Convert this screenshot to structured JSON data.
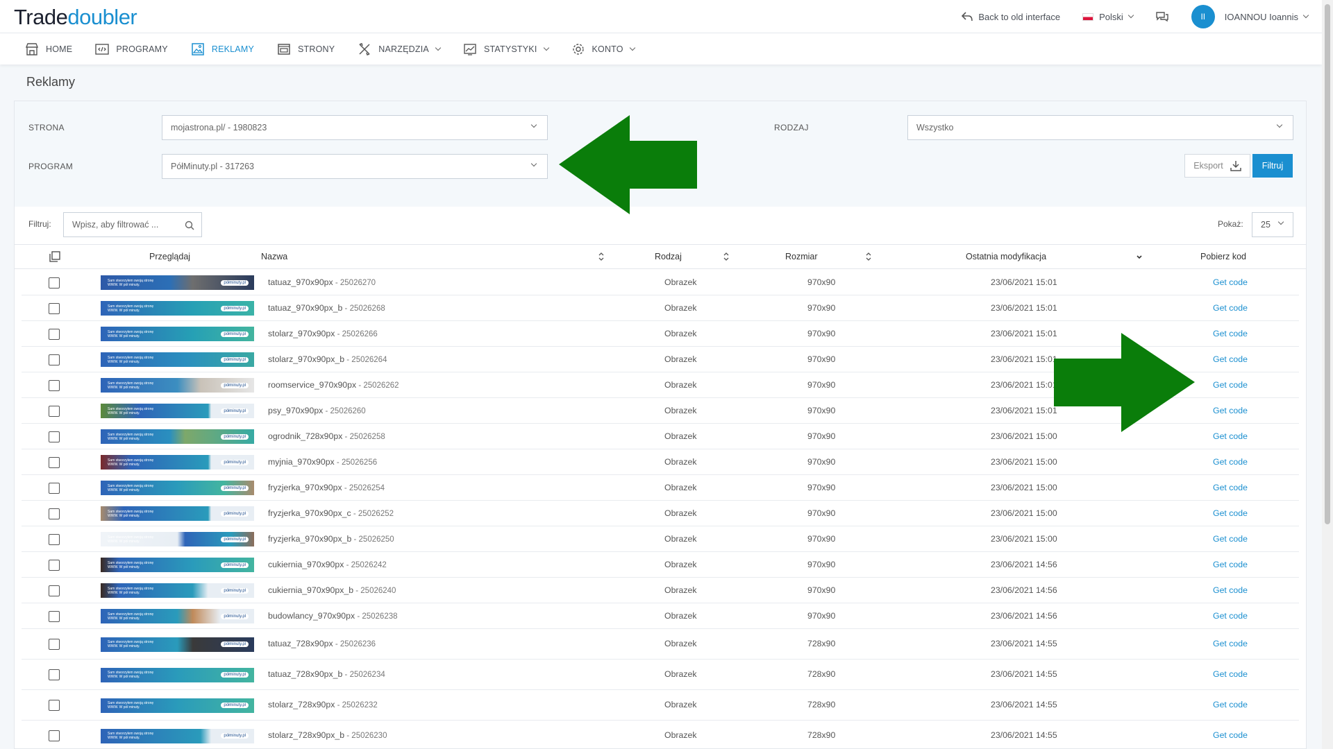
{
  "brand": {
    "part1": "Trade",
    "part2": "doubler"
  },
  "topbar": {
    "back_label": "Back to old interface",
    "language": "Polski",
    "avatar_initials": "II",
    "user_name": "IOANNOU Ioannis"
  },
  "nav": [
    {
      "label": "HOME",
      "icon": "store-icon"
    },
    {
      "label": "PROGRAMY",
      "icon": "code-window-icon"
    },
    {
      "label": "REKLAMY",
      "icon": "image-icon",
      "active": true
    },
    {
      "label": "STRONY",
      "icon": "browser-icon"
    },
    {
      "label": "NARZĘDZIA",
      "icon": "tools-icon",
      "dropdown": true
    },
    {
      "label": "STATYSTYKI",
      "icon": "chart-icon",
      "dropdown": true
    },
    {
      "label": "KONTO",
      "icon": "gear-icon",
      "dropdown": true
    }
  ],
  "page_title": "Reklamy",
  "filters": {
    "strona_label": "STRONA",
    "strona_value": "mojastrona.pl/ - 1980823",
    "program_label": "PROGRAM",
    "program_value": "PółMinuty.pl - 317263",
    "rodzaj_label": "RODZAJ",
    "rodzaj_value": "Wszystko",
    "export_label": "Eksport",
    "filter_button": "Filtruj"
  },
  "search": {
    "label": "Filtruj:",
    "placeholder": "Wpisz, aby filtrować ..."
  },
  "pager": {
    "label": "Pokaż:",
    "value": "25"
  },
  "table": {
    "headers": {
      "preview": "Przeglądaj",
      "name": "Nazwa",
      "kind": "Rodzaj",
      "size": "Rozmiar",
      "modified": "Ostatnia modyfikacja",
      "code": "Pobierz kod"
    },
    "rows": [
      {
        "name": "tatuaz_970x90px",
        "id": " - 25026270",
        "kind": "Obrazek",
        "size": "970x90",
        "date": "23/06/2021 15:01",
        "code": "Get code"
      },
      {
        "name": "tatuaz_970x90px_b",
        "id": " - 25026268",
        "kind": "Obrazek",
        "size": "970x90",
        "date": "23/06/2021 15:01",
        "code": "Get code"
      },
      {
        "name": "stolarz_970x90px",
        "id": " - 25026266",
        "kind": "Obrazek",
        "size": "970x90",
        "date": "23/06/2021 15:01",
        "code": "Get code"
      },
      {
        "name": "stolarz_970x90px_b",
        "id": " - 25026264",
        "kind": "Obrazek",
        "size": "970x90",
        "date": "23/06/2021 15:01",
        "code": "Get code"
      },
      {
        "name": "roomservice_970x90px",
        "id": " - 25026262",
        "kind": "Obrazek",
        "size": "970x90",
        "date": "23/06/2021 15:01",
        "code": "Get code"
      },
      {
        "name": "psy_970x90px",
        "id": " - 25026260",
        "kind": "Obrazek",
        "size": "970x90",
        "date": "23/06/2021 15:01",
        "code": "Get code"
      },
      {
        "name": "ogrodnik_728x90px",
        "id": " - 25026258",
        "kind": "Obrazek",
        "size": "970x90",
        "date": "23/06/2021 15:00",
        "code": "Get code"
      },
      {
        "name": "myjnia_970x90px",
        "id": " - 25026256",
        "kind": "Obrazek",
        "size": "970x90",
        "date": "23/06/2021 15:00",
        "code": "Get code"
      },
      {
        "name": "fryzjerka_970x90px",
        "id": " - 25026254",
        "kind": "Obrazek",
        "size": "970x90",
        "date": "23/06/2021 15:00",
        "code": "Get code"
      },
      {
        "name": "fryzjerka_970x90px_c",
        "id": " - 25026252",
        "kind": "Obrazek",
        "size": "970x90",
        "date": "23/06/2021 15:00",
        "code": "Get code"
      },
      {
        "name": "fryzjerka_970x90px_b",
        "id": " - 25026250",
        "kind": "Obrazek",
        "size": "970x90",
        "date": "23/06/2021 15:00",
        "code": "Get code"
      },
      {
        "name": "cukiernia_970x90px",
        "id": " - 25026242",
        "kind": "Obrazek",
        "size": "970x90",
        "date": "23/06/2021 14:56",
        "code": "Get code"
      },
      {
        "name": "cukiernia_970x90px_b",
        "id": " - 25026240",
        "kind": "Obrazek",
        "size": "970x90",
        "date": "23/06/2021 14:56",
        "code": "Get code"
      },
      {
        "name": "budowlancy_970x90px",
        "id": " - 25026238",
        "kind": "Obrazek",
        "size": "970x90",
        "date": "23/06/2021 14:56",
        "code": "Get code"
      },
      {
        "name": "tatuaz_728x90px",
        "id": " - 25026236",
        "kind": "Obrazek",
        "size": "728x90",
        "date": "23/06/2021 14:55",
        "code": "Get code"
      },
      {
        "name": "tatuaz_728x90px_b",
        "id": " - 25026234",
        "kind": "Obrazek",
        "size": "728x90",
        "date": "23/06/2021 14:55",
        "code": "Get code"
      },
      {
        "name": "stolarz_728x90px",
        "id": " - 25026232",
        "kind": "Obrazek",
        "size": "728x90",
        "date": "23/06/2021 14:55",
        "code": "Get code"
      },
      {
        "name": "stolarz_728x90px_b",
        "id": " - 25026230",
        "kind": "Obrazek",
        "size": "728x90",
        "date": "23/06/2021 14:55",
        "code": "Get code"
      }
    ]
  },
  "banner_text": "Sam stworzyłem swoją stronę WWW. W pół minuty.",
  "banner_logo": "półminuty.pl",
  "colors": {
    "accent": "#1a8fd0",
    "arrow": "#0a7d0a"
  }
}
